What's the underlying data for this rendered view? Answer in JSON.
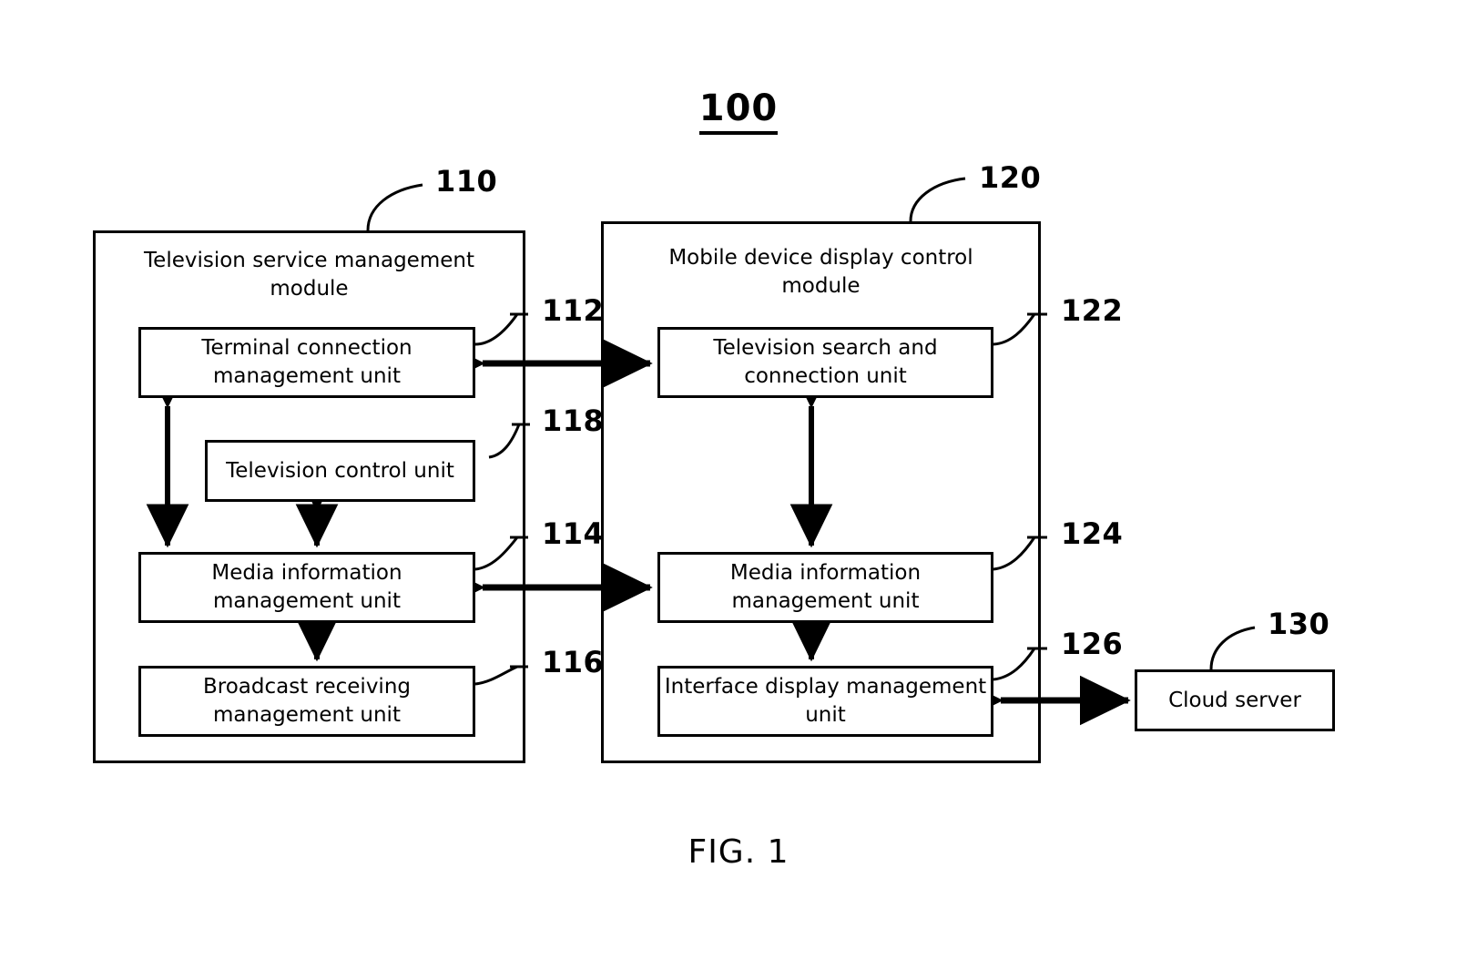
{
  "figure": {
    "number": "100",
    "caption": "FIG. 1"
  },
  "modules": [
    {
      "ref": "110",
      "title": "Television service management module",
      "units": [
        {
          "ref": "112",
          "label": "Terminal connection management unit"
        },
        {
          "ref": "118",
          "label": "Television control unit"
        },
        {
          "ref": "114",
          "label": "Media information management unit"
        },
        {
          "ref": "116",
          "label": "Broadcast receiving management unit"
        }
      ]
    },
    {
      "ref": "120",
      "title": "Mobile device display control module",
      "units": [
        {
          "ref": "122",
          "label": "Television search and connection unit"
        },
        {
          "ref": "124",
          "label": "Media information management unit"
        },
        {
          "ref": "126",
          "label": "Interface display management unit"
        }
      ]
    }
  ],
  "external": {
    "ref": "130",
    "label": "Cloud server"
  },
  "colors": {
    "stroke": "#000000",
    "background": "#ffffff"
  }
}
